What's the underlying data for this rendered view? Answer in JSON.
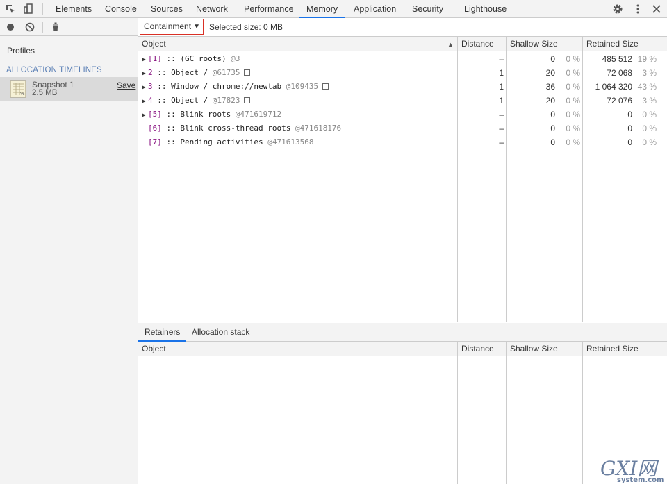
{
  "top_tabs": [
    {
      "label": "Elements",
      "active": false
    },
    {
      "label": "Console",
      "active": false
    },
    {
      "label": "Sources",
      "active": false
    },
    {
      "label": "Network",
      "active": false
    },
    {
      "label": "Performance",
      "active": false
    },
    {
      "label": "Memory",
      "active": true
    },
    {
      "label": "Application",
      "active": false
    },
    {
      "label": "Security",
      "active": false
    },
    {
      "label": "Lighthouse",
      "active": false
    }
  ],
  "toolbar_icons": [
    "inspect-element-icon",
    "device-toolbar-icon",
    "settings-gear-icon",
    "more-vertical-icon",
    "close-icon"
  ],
  "sidebar": {
    "profiles_label": "Profiles",
    "section_title": "ALLOCATION TIMELINES",
    "snapshot": {
      "name": "Snapshot 1",
      "size": "2.5 MB",
      "save_label": "Save"
    }
  },
  "view_toolbar": {
    "view_select": "Containment",
    "selected_size": "Selected size: 0 MB"
  },
  "columns": [
    "Object",
    "Distance",
    "Shallow Size",
    "Retained Size"
  ],
  "rows": [
    {
      "expandable": true,
      "index": "[1]",
      "sep": " :: ",
      "name": "(GC roots) ",
      "id": "@3",
      "box": false,
      "distance": "–",
      "shallow": "0",
      "shallow_pct": "0 %",
      "retained": "485 512",
      "retained_pct": "19 %"
    },
    {
      "expandable": true,
      "index": "2",
      "sep": " :: ",
      "name": "Object /  ",
      "id": "@61735",
      "box": true,
      "distance": "1",
      "shallow": "20",
      "shallow_pct": "0 %",
      "retained": "72 068",
      "retained_pct": "3 %"
    },
    {
      "expandable": true,
      "index": "3",
      "sep": " :: ",
      "name": "Window / chrome://newtab ",
      "id": "@109435",
      "box": true,
      "distance": "1",
      "shallow": "36",
      "shallow_pct": "0 %",
      "retained": "1 064 320",
      "retained_pct": "43 %"
    },
    {
      "expandable": true,
      "index": "4",
      "sep": " :: ",
      "name": "Object /  ",
      "id": "@17823",
      "box": true,
      "distance": "1",
      "shallow": "20",
      "shallow_pct": "0 %",
      "retained": "72 076",
      "retained_pct": "3 %"
    },
    {
      "expandable": true,
      "index": "[5]",
      "sep": " :: ",
      "name": "Blink roots ",
      "id": "@471619712",
      "box": false,
      "distance": "–",
      "shallow": "0",
      "shallow_pct": "0 %",
      "retained": "0",
      "retained_pct": "0 %"
    },
    {
      "expandable": false,
      "index": "[6]",
      "sep": " :: ",
      "name": "Blink cross-thread roots ",
      "id": "@471618176",
      "box": false,
      "distance": "–",
      "shallow": "0",
      "shallow_pct": "0 %",
      "retained": "0",
      "retained_pct": "0 %"
    },
    {
      "expandable": false,
      "index": "[7]",
      "sep": " :: ",
      "name": "Pending activities ",
      "id": "@471613568",
      "box": false,
      "distance": "–",
      "shallow": "0",
      "shallow_pct": "0 %",
      "retained": "0",
      "retained_pct": "0 %"
    }
  ],
  "bottom_tabs": [
    {
      "label": "Retainers",
      "active": true
    },
    {
      "label": "Allocation stack",
      "active": false
    }
  ],
  "bottom_columns": [
    "Object",
    "Distance",
    "Shallow Size",
    "Retained Size"
  ],
  "watermark": {
    "brand": "GXI网",
    "domain": "system.com"
  }
}
